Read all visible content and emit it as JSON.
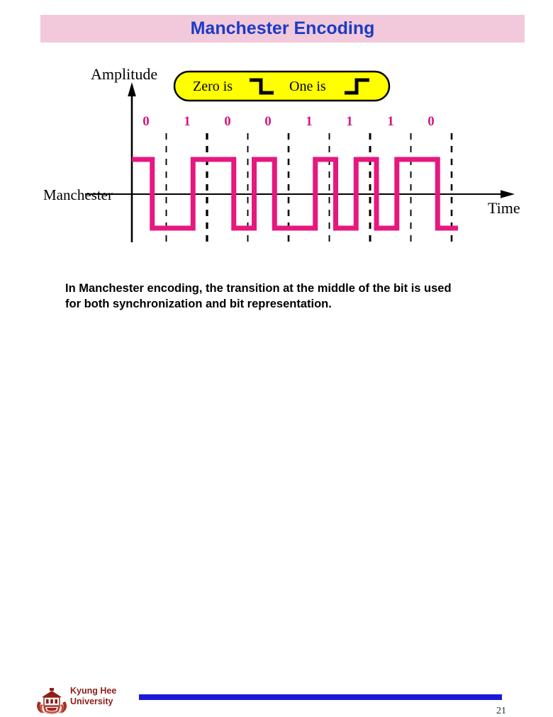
{
  "slide": {
    "title": "Manchester Encoding",
    "title_color": "#1a3bc4",
    "title_bar_color": "#f2c9da"
  },
  "figure": {
    "y_axis_label": "Amplitude",
    "x_axis_label": "Time",
    "signal_label": "Manchester",
    "signal_color": "#e6187f",
    "axis_color": "#000000",
    "bit_label_color": "#d6197f",
    "legend": {
      "background": "#ffff00",
      "border": "#000000",
      "zero_label": "Zero is",
      "zero_glyph": "falling-edge",
      "one_label": "One is",
      "one_glyph": "rising-edge"
    },
    "bits": [
      "0",
      "1",
      "0",
      "0",
      "1",
      "1",
      "1",
      "0"
    ]
  },
  "chart_data": {
    "type": "line",
    "title": "Manchester Encoding",
    "xlabel": "Time",
    "ylabel": "Amplitude",
    "bit_sequence": [
      0,
      1,
      0,
      0,
      1,
      1,
      1,
      0
    ],
    "encoding_rule": {
      "0": "high-to-low transition at middle of bit",
      "1": "low-to-high transition at middle of bit"
    },
    "levels": {
      "high": 1,
      "low": -1
    },
    "grid": "dashed vertical lines at bit boundaries and bit midpoints",
    "legend": [
      "Zero is falling edge",
      "One is rising edge"
    ],
    "series": [
      {
        "name": "Manchester signal",
        "points": [
          [
            0.0,
            1
          ],
          [
            0.5,
            1
          ],
          [
            0.5,
            -1
          ],
          [
            1.0,
            -1
          ],
          [
            1.0,
            -1
          ],
          [
            1.5,
            -1
          ],
          [
            1.5,
            1
          ],
          [
            2.0,
            1
          ],
          [
            2.0,
            1
          ],
          [
            2.5,
            1
          ],
          [
            2.5,
            -1
          ],
          [
            3.0,
            -1
          ],
          [
            3.0,
            1
          ],
          [
            3.5,
            1
          ],
          [
            3.5,
            -1
          ],
          [
            4.0,
            -1
          ],
          [
            4.0,
            -1
          ],
          [
            4.5,
            -1
          ],
          [
            4.5,
            1
          ],
          [
            5.0,
            1
          ],
          [
            5.0,
            -1
          ],
          [
            5.5,
            -1
          ],
          [
            5.5,
            1
          ],
          [
            6.0,
            1
          ],
          [
            6.0,
            -1
          ],
          [
            6.5,
            -1
          ],
          [
            6.5,
            1
          ],
          [
            7.0,
            1
          ],
          [
            7.0,
            1
          ],
          [
            7.5,
            1
          ],
          [
            7.5,
            -1
          ],
          [
            8.0,
            -1
          ]
        ]
      }
    ]
  },
  "caption": {
    "line1": "In Manchester encoding, the transition at the middle of the bit is used",
    "line2": "for both synchronization and bit representation."
  },
  "footer": {
    "logo_line1": "Kyung Hee",
    "logo_line2": "University",
    "logo_color": "#8e2018",
    "rule_color": "#1a1ad6",
    "page_number": "21"
  }
}
